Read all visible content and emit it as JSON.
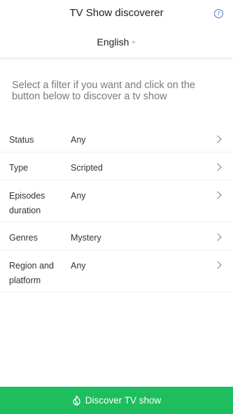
{
  "header": {
    "title": "TV Show discoverer",
    "help_icon": "question-circle-icon",
    "help_glyph": "?"
  },
  "language": {
    "selected": "English"
  },
  "intro_text": "Select a filter if you want and click on the button below to discover a tv show",
  "filters": [
    {
      "label": "Status",
      "value": "Any"
    },
    {
      "label": "Type",
      "value": "Scripted"
    },
    {
      "label": "Episodes duration",
      "value": "Any"
    },
    {
      "label": "Genres",
      "value": "Mystery"
    },
    {
      "label": "Region and platform",
      "value": "Any"
    }
  ],
  "discover_button": {
    "label": "Discover TV show",
    "icon": "flame-icon"
  },
  "colors": {
    "accent": "#1ebd5d",
    "help_icon": "#3d7bd9",
    "intro_text": "#7a7a7a"
  }
}
